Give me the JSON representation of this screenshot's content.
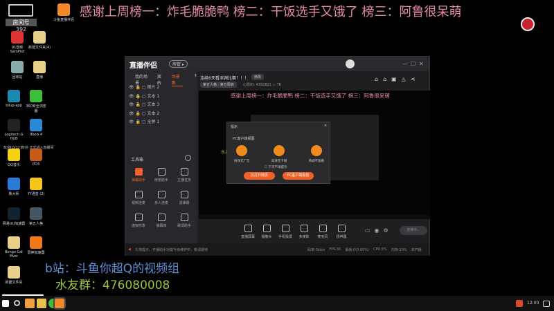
{
  "overlay": {
    "banner": "感谢上周榜一：炸毛脆脆鸭 榜二：干饭选手又饿了 榜三：阿鲁很呆萌",
    "bilibili": "b站：斗鱼你超Q的视频组",
    "qq_group": "水友群：476080008",
    "room_label": "房间号",
    "room_number": "392"
  },
  "desktop_icons": [
    {
      "label": "斗鱼直播伴侣",
      "color": "#f0882a"
    },
    {
      "label": "91音频 SamProf",
      "color": "#d33"
    },
    {
      "label": "新建文件夹(4)",
      "color": "#e8d08a"
    },
    {
      "label": "回收站",
      "color": "#8aa"
    },
    {
      "label": "直播",
      "color": "#e8d08a"
    },
    {
      "label": "bilup-app",
      "color": "#1a8ab0"
    },
    {
      "label": "360安全浏览器",
      "color": "#3bbf3b"
    },
    {
      "label": "Logitech G HUB",
      "color": "#222"
    },
    {
      "label": "iTools 4",
      "color": "#2a8ad8"
    },
    {
      "label": "QQ音乐",
      "color": "#f5d20f"
    },
    {
      "label": "PD3",
      "color": "#c85a1a"
    },
    {
      "label": "鲁大师",
      "color": "#2a7ad8"
    },
    {
      "label": "YY语音 (2)",
      "color": "#f5c518"
    },
    {
      "label": "网易UU加速器",
      "color": "#123"
    },
    {
      "label": "第五人格",
      "color": "#456"
    },
    {
      "label": "Bongo Cat Mver",
      "color": "#e8d08a"
    },
    {
      "label": "雷神加速器",
      "color": "#f07a1a"
    },
    {
      "label": "新建文件夹",
      "color": "#e8d08a"
    }
  ],
  "notice": "欢迎[LV12]粉丝 正式进入直播间",
  "taskbar": {
    "clock": "12:00"
  },
  "app": {
    "name": "直播伴侣",
    "version_badge": "房管 ▸",
    "window_controls": [
      "—",
      "☐",
      "✕"
    ],
    "left_tabs": [
      "我的场景",
      "双击",
      "场景集"
    ],
    "add": "+",
    "layers": [
      "图片 2",
      "文本 1",
      "文本 3",
      "文本 2",
      "全屏 1"
    ],
    "toolbox_title": "工具箱",
    "tools": [
      "弹幕助手",
      "房管助手",
      "主播任务",
      "视频连麦",
      "多人连麦",
      "滤弹幕",
      "虚拟形象",
      "弹幕库",
      "歌词助手"
    ],
    "stream_title": "连续6天看深渊比赛！！！",
    "edit": "修改",
    "category": "第五人格 · 第五周转",
    "room_id_label": "心愿ID:",
    "room_id": "4392821",
    "heat": "76",
    "controls": [
      "直播屏幕",
      "摄像头",
      "手机投屏",
      "多媒体",
      "麦克风",
      "扬声器"
    ],
    "start_button": "连接中...",
    "status_message": "礼物提示，开播助手功能升级维护中，敬请期待",
    "stats": [
      "码率:0kb/s",
      "FPS:30",
      "丢帧:0(0.00%)",
      "CPU:5%",
      "内存:20%",
      "未开播"
    ],
    "dialog": {
      "title": "提示",
      "subtitle": "PC客户端视图",
      "features": [
        "纯净无广告",
        "高清无卡顿",
        "商城不迷路"
      ],
      "checkbox": "下次不再提示",
      "btn_web": "仍打开网页",
      "btn_pc": "PC客户端观看",
      "close": "✕"
    }
  }
}
